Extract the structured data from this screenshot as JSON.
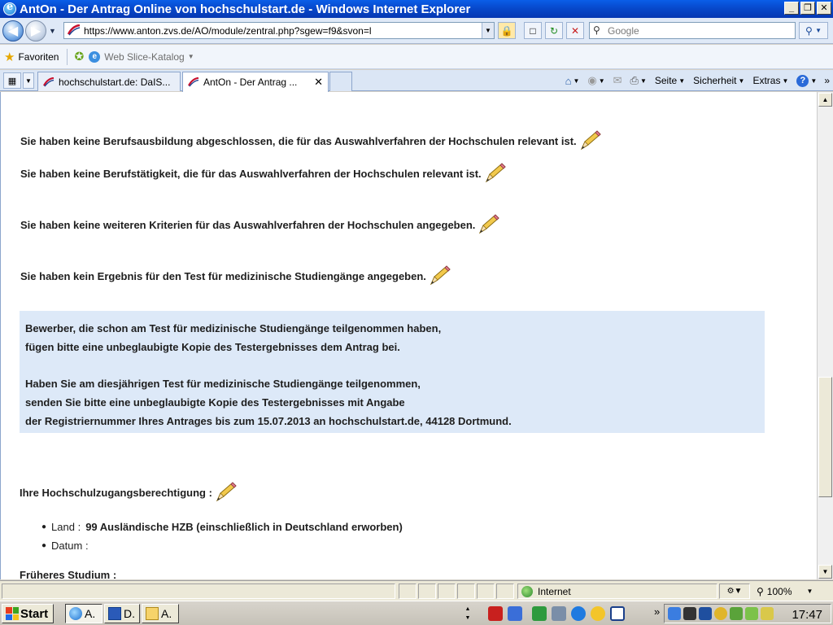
{
  "window": {
    "title": "AntOn - Der Antrag Online von hochschulstart.de - Windows Internet Explorer",
    "minimize": "_",
    "restore": "❐",
    "close": "✕"
  },
  "address_bar": {
    "url": "https://www.anton.zvs.de/AO/module/zentral.php?sgew=f9&svon=l",
    "search_placeholder": "Google"
  },
  "favorites_bar": {
    "favorites_label": "Favoriten",
    "web_slice_label": "Web Slice-Katalog"
  },
  "tabs": [
    {
      "label": "hochschulstart.de: DaIS..."
    },
    {
      "label": "AntOn - Der Antrag ..."
    }
  ],
  "command_bar": {
    "page": "Seite",
    "security": "Sicherheit",
    "extras": "Extras"
  },
  "content": {
    "line1": "Sie haben keine Berufsausbildung abgeschlossen, die für das Auswahlverfahren der Hochschulen relevant ist.",
    "line2": "Sie haben keine Berufstätigkeit, die für das Auswahlverfahren der Hochschulen relevant ist.",
    "line3": "Sie haben keine weiteren Kriterien für das Auswahlverfahren der Hochschulen angegeben.",
    "line4": "Sie haben kein Ergebnis für den Test für medizinische Studiengänge angegeben.",
    "info": {
      "p1_l1": "Bewerber, die schon am Test für medizinische Studiengänge teilgenommen haben,",
      "p1_l2": "fügen bitte eine unbeglaubigte Kopie des Testergebnisses dem Antrag bei.",
      "p2_l1": "Haben Sie am diesjährigen Test für medizinische Studiengänge teilgenommen,",
      "p2_l2": "senden Sie bitte eine unbeglaubigte Kopie des Testergebnisses mit Angabe",
      "p2_l3": "der Registriernummer Ihres Antrages bis zum 15.07.2013 an hochschulstart.de, 44128 Dortmund."
    },
    "hzb_heading": "Ihre Hochschulzugangsberechtigung :",
    "hzb_items": [
      {
        "label": "Land :",
        "value": "99 Ausländische HZB (einschließlich in Deutschland erworben)"
      },
      {
        "label": "Datum :",
        "value": ""
      }
    ],
    "previous_study_heading": "Früheres Studium :"
  },
  "status_bar": {
    "zone": "Internet",
    "zoom": "100%"
  },
  "taskbar": {
    "start": "Start",
    "buttons": [
      {
        "label": "A."
      },
      {
        "label": "D."
      },
      {
        "label": "A."
      }
    ],
    "clock": "17:47"
  },
  "colors": {
    "info_box_bg": "#dde9f8",
    "title_bar": "#0747c9",
    "text": "#1e1e1e"
  }
}
